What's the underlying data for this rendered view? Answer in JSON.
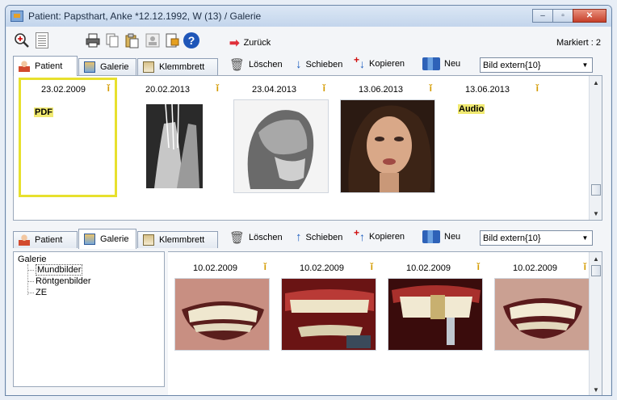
{
  "window": {
    "title": "Patient: Papsthart, Anke  *12.12.1992, W (13)  /  Galerie",
    "buttons": {
      "minimize": "–",
      "maximize": "▫",
      "close": "✕"
    }
  },
  "toolbar": {
    "back_label": "Zurück",
    "marked": "Markiert : 2"
  },
  "top_pane": {
    "tabs": [
      {
        "label": "Patient",
        "active": true
      },
      {
        "label": "Galerie",
        "active": false
      },
      {
        "label": "Klemmbrett",
        "active": false
      }
    ],
    "actions": {
      "delete": "Löschen",
      "move": "Schieben",
      "copy": "Kopieren",
      "new": "Neu"
    },
    "combo_value": "Bild extern{10}",
    "thumbnails": [
      {
        "date": "23.02.2009",
        "type": "PDF",
        "selected": true
      },
      {
        "date": "20.02.2013",
        "type": "image"
      },
      {
        "date": "23.04.2013",
        "type": "image"
      },
      {
        "date": "13.06.2013",
        "type": "image"
      },
      {
        "date": "13.06.2013",
        "type": "Audio"
      }
    ]
  },
  "bottom_pane": {
    "tabs": [
      {
        "label": "Patient",
        "active": false
      },
      {
        "label": "Galerie",
        "active": true
      },
      {
        "label": "Klemmbrett",
        "active": false
      }
    ],
    "actions": {
      "delete": "Löschen",
      "move": "Schieben",
      "copy": "Kopieren",
      "new": "Neu"
    },
    "combo_value": "Bild extern{10}",
    "tree": {
      "root": "Galerie",
      "children": [
        "Mundbilder",
        "Röntgenbilder",
        "ZE"
      ],
      "selected": "Mundbilder"
    },
    "thumbnails": [
      {
        "date": "10.02.2009"
      },
      {
        "date": "10.02.2009"
      },
      {
        "date": "10.02.2009"
      },
      {
        "date": "10.02.2009"
      }
    ]
  },
  "colors": {
    "selection_border": "#e7e02d",
    "info_icon": "#d49b00",
    "back_arrow": "#e0303a"
  }
}
